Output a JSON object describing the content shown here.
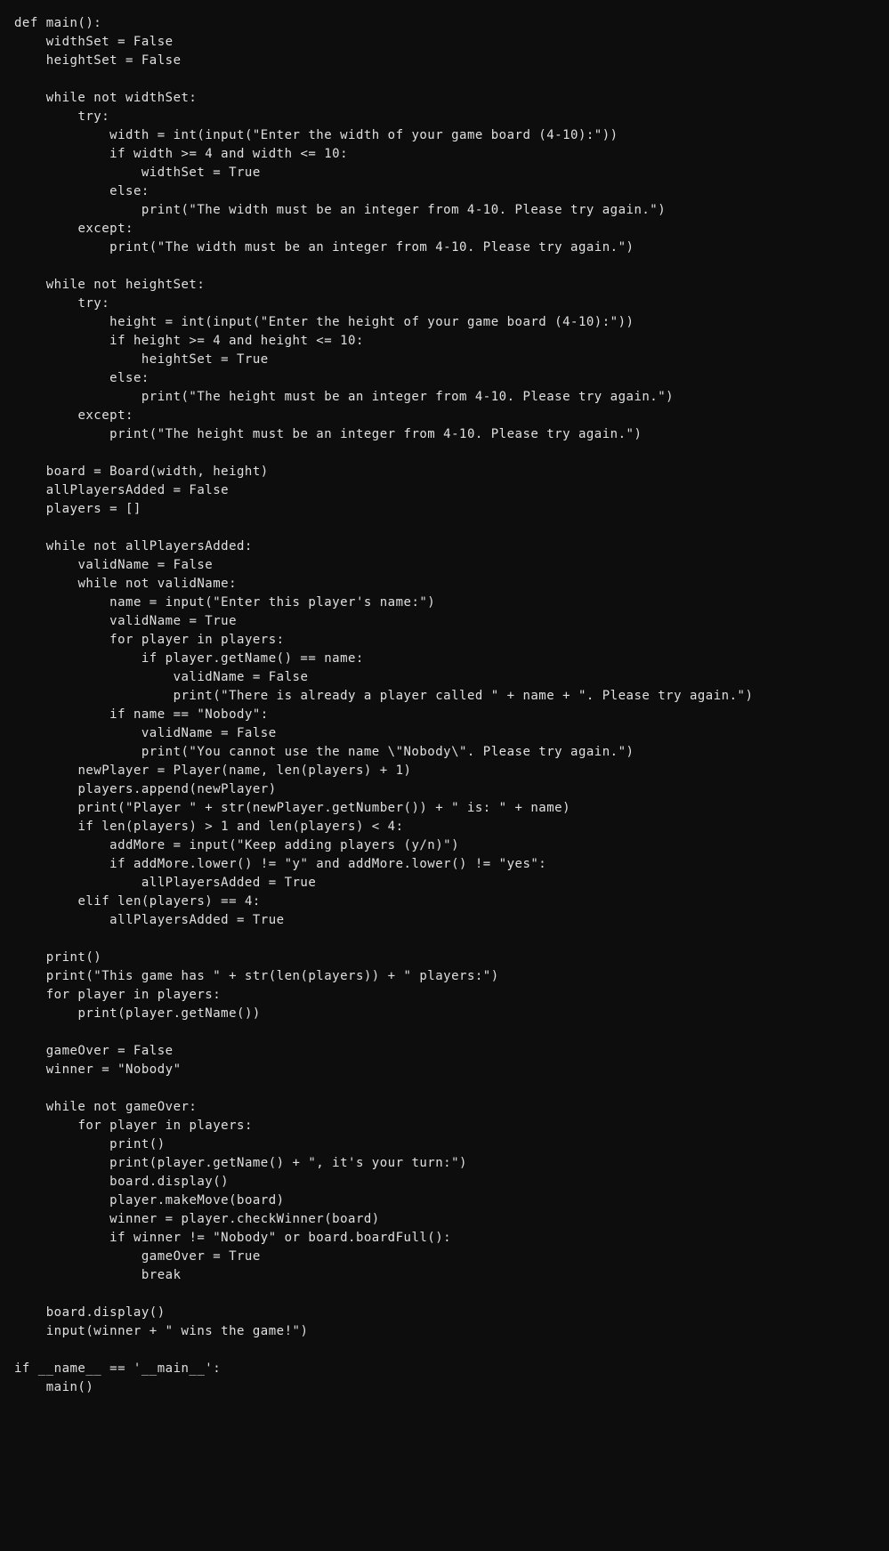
{
  "code": "def main():\n    widthSet = False\n    heightSet = False\n\n    while not widthSet:\n        try:\n            width = int(input(\"Enter the width of your game board (4-10):\"))\n            if width >= 4 and width <= 10:\n                widthSet = True\n            else:\n                print(\"The width must be an integer from 4-10. Please try again.\")\n        except:\n            print(\"The width must be an integer from 4-10. Please try again.\")\n\n    while not heightSet:\n        try:\n            height = int(input(\"Enter the height of your game board (4-10):\"))\n            if height >= 4 and height <= 10:\n                heightSet = True\n            else:\n                print(\"The height must be an integer from 4-10. Please try again.\")\n        except:\n            print(\"The height must be an integer from 4-10. Please try again.\")\n\n    board = Board(width, height)\n    allPlayersAdded = False\n    players = []\n\n    while not allPlayersAdded:\n        validName = False\n        while not validName:\n            name = input(\"Enter this player's name:\")\n            validName = True\n            for player in players:\n                if player.getName() == name:\n                    validName = False\n                    print(\"There is already a player called \" + name + \". Please try again.\")\n            if name == \"Nobody\":\n                validName = False\n                print(\"You cannot use the name \\\"Nobody\\\". Please try again.\")\n        newPlayer = Player(name, len(players) + 1)\n        players.append(newPlayer)\n        print(\"Player \" + str(newPlayer.getNumber()) + \" is: \" + name)\n        if len(players) > 1 and len(players) < 4:\n            addMore = input(\"Keep adding players (y/n)\")\n            if addMore.lower() != \"y\" and addMore.lower() != \"yes\":\n                allPlayersAdded = True\n        elif len(players) == 4:\n            allPlayersAdded = True\n\n    print()\n    print(\"This game has \" + str(len(players)) + \" players:\")\n    for player in players:\n        print(player.getName())\n\n    gameOver = False\n    winner = \"Nobody\"\n\n    while not gameOver:\n        for player in players:\n            print()\n            print(player.getName() + \", it's your turn:\")\n            board.display()\n            player.makeMove(board)\n            winner = player.checkWinner(board)\n            if winner != \"Nobody\" or board.boardFull():\n                gameOver = True\n                break\n\n    board.display()\n    input(winner + \" wins the game!\")\n\nif __name__ == '__main__':\n    main()"
}
